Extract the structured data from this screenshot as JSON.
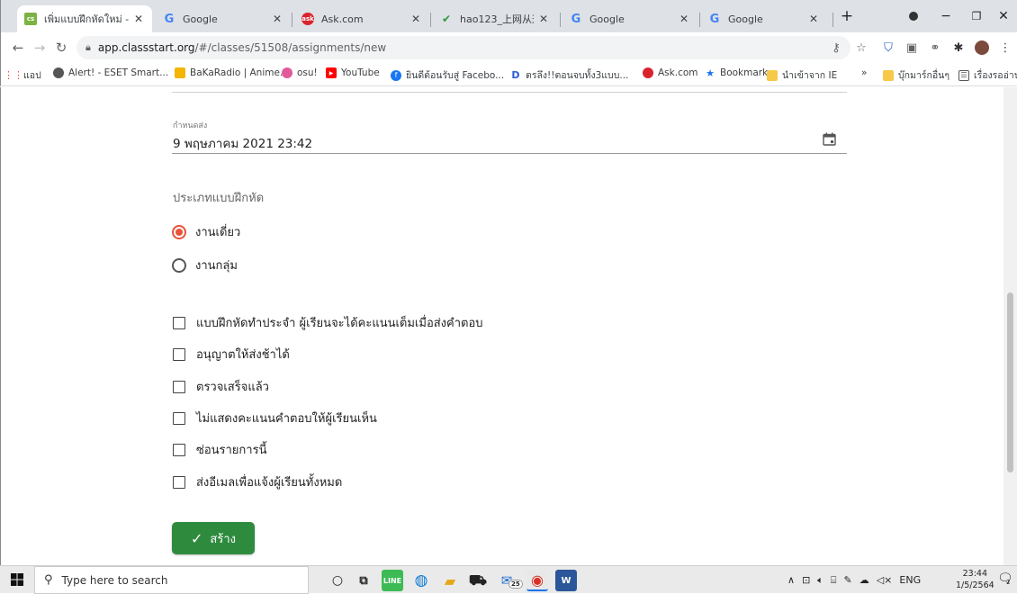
{
  "browser": {
    "tabs": [
      {
        "label": "เพิ่มแบบฝึกหัดใหม่ - Class",
        "icon": "classstart-favicon",
        "active": true
      },
      {
        "label": "Google",
        "icon": "google-favicon",
        "active": false
      },
      {
        "label": "Ask.com",
        "icon": "ask-favicon",
        "active": false
      },
      {
        "label": "hao123_上网从这里开",
        "icon": "hao123-favicon",
        "active": false
      },
      {
        "label": "Google",
        "icon": "google-favicon",
        "active": false
      },
      {
        "label": "Google",
        "icon": "google-favicon",
        "active": false
      }
    ],
    "new_tab": "+",
    "url_host": "app.classstart.org",
    "url_path": "/#/classes/51508/assignments/new",
    "bookmarks": [
      {
        "label": "แอป",
        "icon": "apps-grid-icon",
        "color": "#e8453c"
      },
      {
        "label": "Alert! - ESET Smart...",
        "icon": "globe-icon",
        "color": "#555555"
      },
      {
        "label": "BaKaRadio | Anime...",
        "icon": "bakaradio-icon",
        "color": "#f4b400"
      },
      {
        "label": "osu!",
        "icon": "osu-icon",
        "color": "#e05a9a"
      },
      {
        "label": "YouTube",
        "icon": "youtube-icon",
        "color": "#ff0000"
      },
      {
        "label": "ยินดีต้อนรับสู่ Facebo...",
        "icon": "facebook-icon",
        "color": "#1877f2"
      },
      {
        "label": "ตรลึง!!ตอนจบทั้ง3แบบ...",
        "icon": "d-icon",
        "color": "#2b5cd6"
      },
      {
        "label": "Ask.com",
        "icon": "ask-icon",
        "color": "#d9232d"
      },
      {
        "label": "Bookmarks",
        "icon": "star-icon",
        "color": "#1a73e8"
      },
      {
        "label": "นำเข้าจาก IE",
        "icon": "folder-icon",
        "color": "#f7c948"
      }
    ],
    "bookmarks_overflow": "»",
    "other_bookmarks": "บุ๊กมาร์กอื่นๆ",
    "reading_list": "เรื่องรออ่าน"
  },
  "form": {
    "deadline_label": "กำหนดส่ง",
    "deadline_value": "9 พฤษภาคม 2021 23:42",
    "type_label": "ประเภทแบบฝึกหัด",
    "type_options": [
      {
        "label": "งานเดี่ยว",
        "selected": true
      },
      {
        "label": "งานกลุ่ม",
        "selected": false
      }
    ],
    "options": [
      {
        "label": "แบบฝึกหัดทำประจำ ผู้เรียนจะได้คะแนนเต็มเมื่อส่งคำตอบ",
        "checked": false
      },
      {
        "label": "อนุญาตให้ส่งช้าได้",
        "checked": false
      },
      {
        "label": "ตรวจเสร็จแล้ว",
        "checked": false
      },
      {
        "label": "ไม่แสดงคะแนนคำตอบให้ผู้เรียนเห็น",
        "checked": false
      },
      {
        "label": "ซ่อนรายการนี้",
        "checked": false
      },
      {
        "label": "ส่งอีเมลเพื่อแจ้งผู้เรียนทั้งหมด",
        "checked": false
      }
    ],
    "create_button": "สร้าง",
    "accent_color": "#e8543a",
    "button_color": "#2e8b3e"
  },
  "taskbar": {
    "search_placeholder": "Type here to search",
    "mail_badge": "25",
    "language": "ENG",
    "time": "23:44",
    "date": "1/5/2564",
    "notification_count": "2"
  }
}
